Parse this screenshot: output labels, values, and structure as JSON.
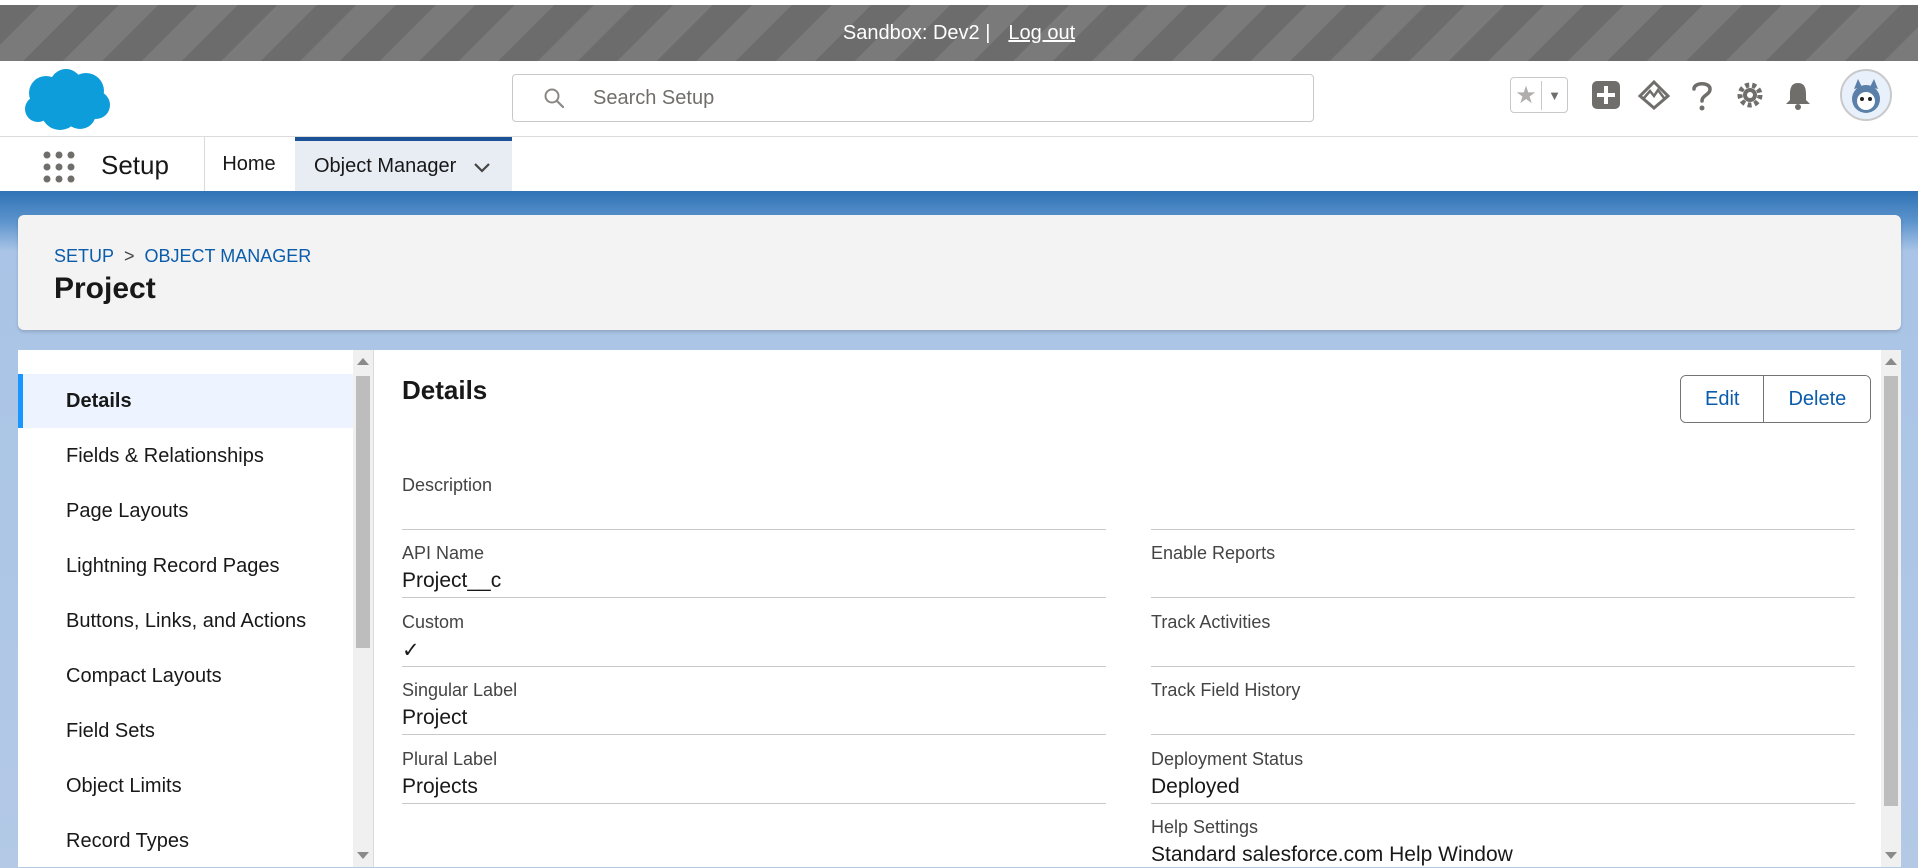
{
  "sandbox": {
    "text": "Sandbox: Dev2 |",
    "logout": "Log out"
  },
  "header": {
    "search_placeholder": "Search Setup",
    "icons": [
      "star-icon",
      "caret-down-icon",
      "add-icon",
      "trailhead-icon",
      "help-icon",
      "gear-icon",
      "bell-icon",
      "avatar"
    ]
  },
  "nav": {
    "app_name": "Setup",
    "tabs": [
      {
        "label": "Home"
      },
      {
        "label": "Object Manager"
      }
    ]
  },
  "page": {
    "breadcrumb": [
      "SETUP",
      "OBJECT MANAGER"
    ],
    "breadcrumb_sep": ">",
    "title": "Project"
  },
  "sidebar": {
    "items": [
      {
        "label": "Details"
      },
      {
        "label": "Fields & Relationships"
      },
      {
        "label": "Page Layouts"
      },
      {
        "label": "Lightning Record Pages"
      },
      {
        "label": "Buttons, Links, and Actions"
      },
      {
        "label": "Compact Layouts"
      },
      {
        "label": "Field Sets"
      },
      {
        "label": "Object Limits"
      },
      {
        "label": "Record Types"
      }
    ]
  },
  "details": {
    "title": "Details",
    "edit_label": "Edit",
    "delete_label": "Delete",
    "left_fields": [
      {
        "label": "Description",
        "value": ""
      },
      {
        "label": "API Name",
        "value": "Project__c"
      },
      {
        "label": "Custom",
        "value": "✓"
      },
      {
        "label": "Singular Label",
        "value": "Project"
      },
      {
        "label": "Plural Label",
        "value": "Projects"
      }
    ],
    "right_fields": [
      {
        "label": "",
        "value": ""
      },
      {
        "label": "Enable Reports",
        "value": ""
      },
      {
        "label": "Track Activities",
        "value": ""
      },
      {
        "label": "Track Field History",
        "value": ""
      },
      {
        "label": "Deployment Status",
        "value": "Deployed"
      },
      {
        "label": "Help Settings",
        "value": "Standard salesforce.com Help Window"
      }
    ]
  },
  "colors": {
    "brand": "#0176d3",
    "link": "#0b5cab",
    "active_tab_border": "#1b5297"
  }
}
